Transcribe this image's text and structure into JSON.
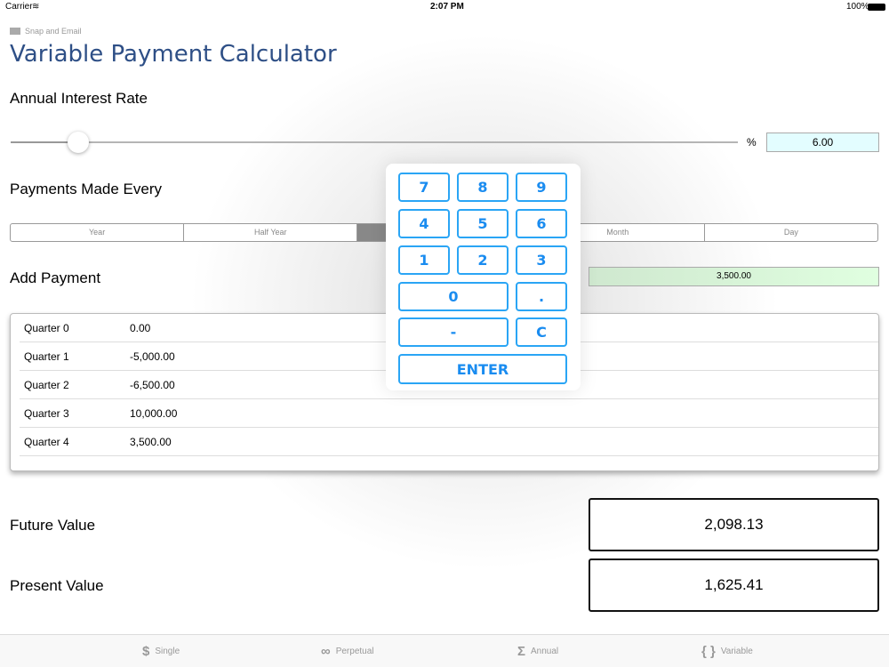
{
  "status": {
    "carrier": "Carrier",
    "time": "2:07 PM",
    "battery": "100%"
  },
  "snap_email": "Snap and Email",
  "title": "Variable Payment Calculator",
  "interest": {
    "label": "Annual Interest Rate",
    "unit": "%",
    "value": "6.00",
    "slider_fraction": 0.08
  },
  "frequency": {
    "label": "Payments Made Every",
    "options": [
      "Year",
      "Half Year",
      "",
      "Month",
      "Day"
    ],
    "selected_index": 2
  },
  "add_payment": {
    "label": "Add Payment",
    "value": "3,500.00"
  },
  "payments": [
    {
      "period": "Quarter 0",
      "amount": "0.00"
    },
    {
      "period": "Quarter 1",
      "amount": "-5,000.00"
    },
    {
      "period": "Quarter 2",
      "amount": "-6,500.00"
    },
    {
      "period": "Quarter 3",
      "amount": "10,000.00"
    },
    {
      "period": "Quarter 4",
      "amount": "3,500.00"
    }
  ],
  "future_value": {
    "label": "Future Value",
    "value": "2,098.13"
  },
  "present_value": {
    "label": "Present Value",
    "value": "1,625.41"
  },
  "keypad": {
    "keys": [
      "7",
      "8",
      "9",
      "4",
      "5",
      "6",
      "1",
      "2",
      "3",
      "0",
      ".",
      "-",
      "C"
    ],
    "enter": "ENTER"
  },
  "tabs": [
    {
      "icon": "$",
      "label": "Single"
    },
    {
      "icon": "∞",
      "label": "Perpetual"
    },
    {
      "icon": "Σ",
      "label": "Annual"
    },
    {
      "icon": "{ }",
      "label": "Variable"
    }
  ]
}
